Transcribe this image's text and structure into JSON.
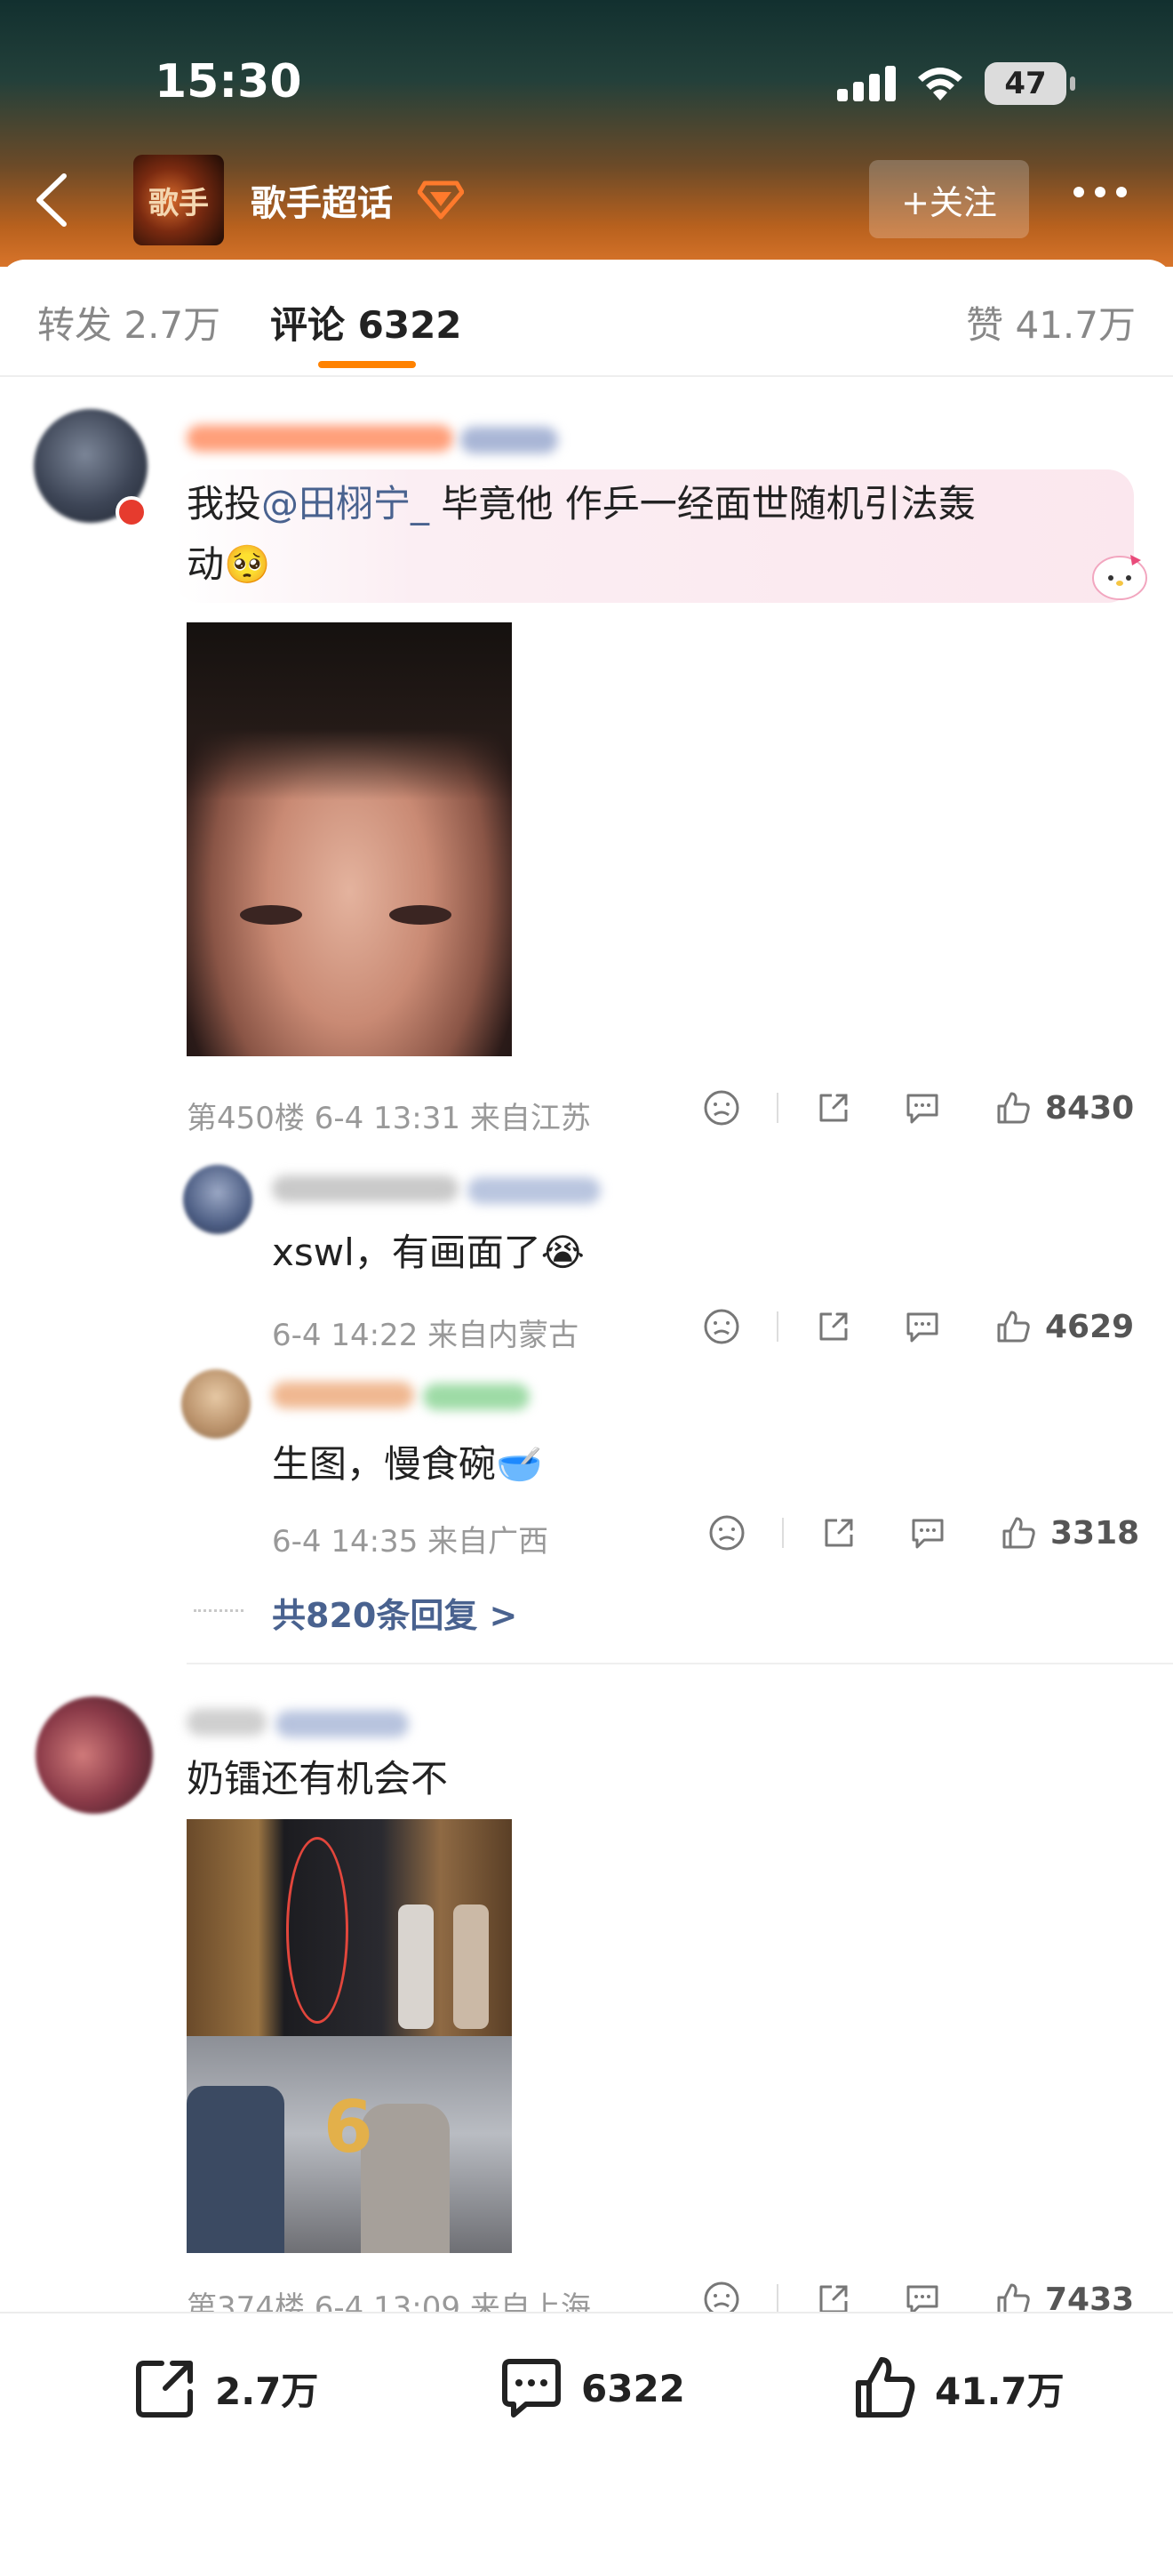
{
  "status": {
    "time": "15:30",
    "battery": "47"
  },
  "topic": {
    "title": "歌手超话",
    "avatar_text": "歌手",
    "follow_label": "+关注"
  },
  "tabs": {
    "repost": "转发 2.7万",
    "comments": "评论 6322",
    "likes": "赞 41.7万"
  },
  "comments": [
    {
      "text_prefix": "我投",
      "mention": "@田栩宁_",
      "text_suffix": " 毕竟他 作乒一经面世随机引法轰",
      "text_line2": "动🥺",
      "meta": "第450楼 6-4 13:31 来自江苏",
      "likes": "8430",
      "replies": [
        {
          "text": "xswl，有画面了😭",
          "meta": "6-4 14:22 来自内蒙古",
          "likes": "4629"
        },
        {
          "text": "生图，慢食碗🥣",
          "meta": "6-4 14:35 来自广西",
          "likes": "3318"
        }
      ],
      "more_replies": "共820条回复 >"
    },
    {
      "text": "奶镭还有机会不",
      "meta": "第374楼 6-4 13:09 来自上海",
      "likes": "7433"
    }
  ],
  "bottom_bar": {
    "repost": "2.7万",
    "comments": "6322",
    "likes": "41.7万"
  }
}
